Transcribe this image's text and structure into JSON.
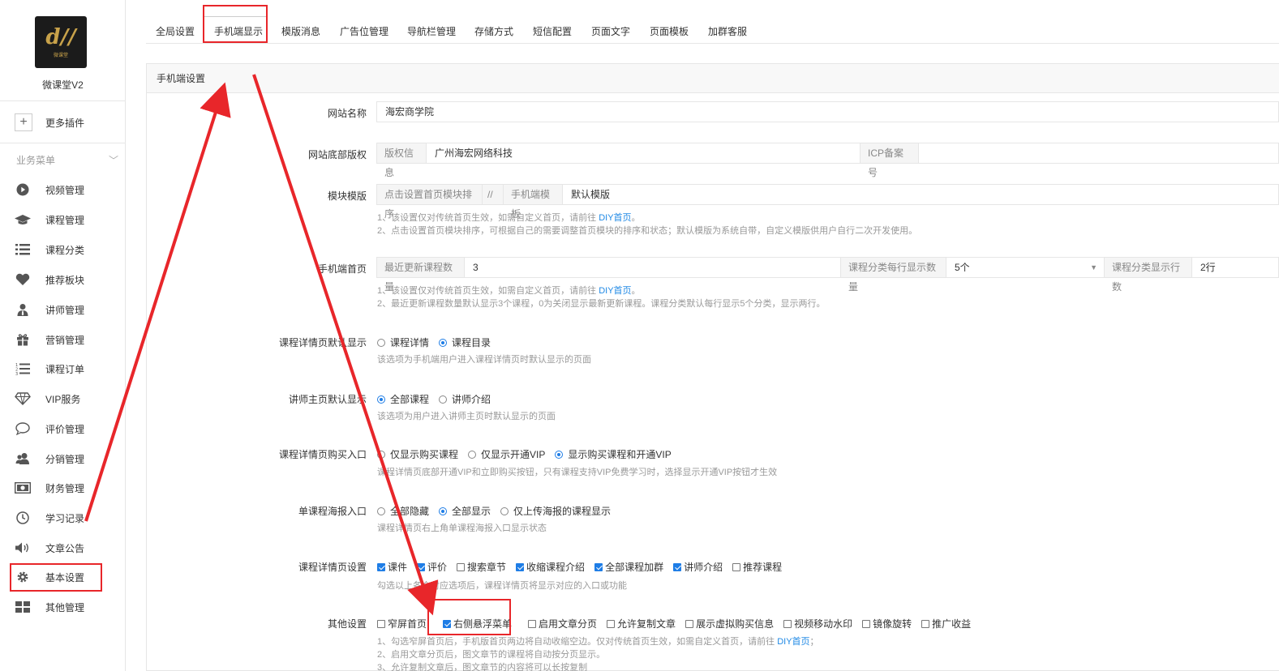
{
  "app": {
    "name": "微课堂V2",
    "logo_text": "微课堂"
  },
  "sidebar": {
    "more_plugins": "更多插件",
    "section_title": "业务菜单",
    "items": [
      {
        "label": "视频管理",
        "icon": "play-circle-icon"
      },
      {
        "label": "课程管理",
        "icon": "graduation-cap-icon"
      },
      {
        "label": "课程分类",
        "icon": "list-icon"
      },
      {
        "label": "推荐板块",
        "icon": "heart-icon"
      },
      {
        "label": "讲师管理",
        "icon": "user-tie-icon"
      },
      {
        "label": "营销管理",
        "icon": "gift-icon"
      },
      {
        "label": "课程订单",
        "icon": "ordered-list-icon"
      },
      {
        "label": "VIP服务",
        "icon": "diamond-icon"
      },
      {
        "label": "评价管理",
        "icon": "comment-icon"
      },
      {
        "label": "分销管理",
        "icon": "users-icon"
      },
      {
        "label": "财务管理",
        "icon": "money-icon"
      },
      {
        "label": "学习记录",
        "icon": "clock-icon"
      },
      {
        "label": "文章公告",
        "icon": "volume-icon"
      },
      {
        "label": "基本设置",
        "icon": "gear-icon"
      },
      {
        "label": "其他管理",
        "icon": "grid-icon"
      }
    ]
  },
  "tabs": [
    "全局设置",
    "手机端显示",
    "模版消息",
    "广告位管理",
    "导航栏管理",
    "存储方式",
    "短信配置",
    "页面文字",
    "页面模板",
    "加群客服"
  ],
  "panel": {
    "title": "手机端设置"
  },
  "form": {
    "site_name": {
      "label": "网站名称",
      "value": "海宏商学院"
    },
    "footer": {
      "label": "网站底部版权",
      "copyright_addon": "版权信息",
      "copyright_value": "广州海宏网络科技",
      "icp_addon": "ICP备案号",
      "icp_value": ""
    },
    "module": {
      "label": "模块模版",
      "addon1": "点击设置首页模块排序",
      "sep": "//",
      "addon2": "手机端模板",
      "value": "默认模版",
      "help1_pre": "1、该设置仅对传统首页生效，如需自定义首页，请前往",
      "help1_link": "DIY首页",
      "help1_post": "。",
      "help2": "2、点击设置首页模块排序，可根据自己的需要调整首页模块的排序和状态；默认模版为系统自带，自定义模版供用户自行二次开发使用。"
    },
    "home": {
      "label": "手机端首页",
      "addon1": "最近更新课程数量",
      "value1": "3",
      "addon2": "课程分类每行显示数量",
      "value2": "5个",
      "addon3": "课程分类显示行数",
      "value3": "2行",
      "help1_pre": "1、该设置仅对传统首页生效，如需自定义首页，请前往",
      "help1_link": "DIY首页",
      "help1_post": "。",
      "help2": "2、最近更新课程数量默认显示3个课程，0为关闭显示最新更新课程。课程分类默认每行显示5个分类，显示两行。"
    },
    "course_detail_default": {
      "label": "课程详情页默认显示",
      "options": [
        "课程详情",
        "课程目录"
      ],
      "selected": 1,
      "help": "该选项为手机端用户进入课程详情页时默认显示的页面"
    },
    "teacher_default": {
      "label": "讲师主页默认显示",
      "options": [
        "全部课程",
        "讲师介绍"
      ],
      "selected": 0,
      "help": "该选项为用户进入讲师主页时默认显示的页面"
    },
    "buy_entry": {
      "label": "课程详情页购买入口",
      "options": [
        "仅显示购买课程",
        "仅显示开通VIP",
        "显示购买课程和开通VIP"
      ],
      "selected": 2,
      "help": "课程详情页底部开通VIP和立即购买按钮，只有课程支持VIP免费学习时，选择显示开通VIP按钮才生效"
    },
    "poster_entry": {
      "label": "单课程海报入口",
      "options": [
        "全部隐藏",
        "全部显示",
        "仅上传海报的课程显示"
      ],
      "selected": 1,
      "help": "课程详情页右上角单课程海报入口显示状态"
    },
    "detail_settings": {
      "label": "课程详情页设置",
      "options": [
        {
          "text": "课件",
          "checked": true
        },
        {
          "text": "评价",
          "checked": true
        },
        {
          "text": "搜索章节",
          "checked": false
        },
        {
          "text": "收缩课程介绍",
          "checked": true
        },
        {
          "text": "全部课程加群",
          "checked": true
        },
        {
          "text": "讲师介绍",
          "checked": true
        },
        {
          "text": "推荐课程",
          "checked": false
        }
      ],
      "help": "勾选以上各个对应选项后，课程详情页将显示对应的入口或功能"
    },
    "other_settings": {
      "label": "其他设置",
      "options": [
        {
          "text": "窄屏首页",
          "checked": false
        },
        {
          "text": "右侧悬浮菜单",
          "checked": true
        },
        {
          "text": "启用文章分页",
          "checked": false
        },
        {
          "text": "允许复制文章",
          "checked": false
        },
        {
          "text": "展示虚拟购买信息",
          "checked": false
        },
        {
          "text": "视频移动水印",
          "checked": false
        },
        {
          "text": "镜像旋转",
          "checked": false
        },
        {
          "text": "推广收益",
          "checked": false
        }
      ],
      "help1_pre": "1、勾选窄屏首页后，手机版首页两边将自动收缩空边。仅对传统首页生效，如需自定义首页，请前往",
      "help1_link": "DIY首页",
      "help1_post": "；",
      "help2": "2、启用文章分页后，图文章节的课程将自动按分页显示。",
      "help3": "3、允许复制文章后，图文章节的内容将可以长按复制"
    }
  },
  "annotation_color": "#e8262a"
}
